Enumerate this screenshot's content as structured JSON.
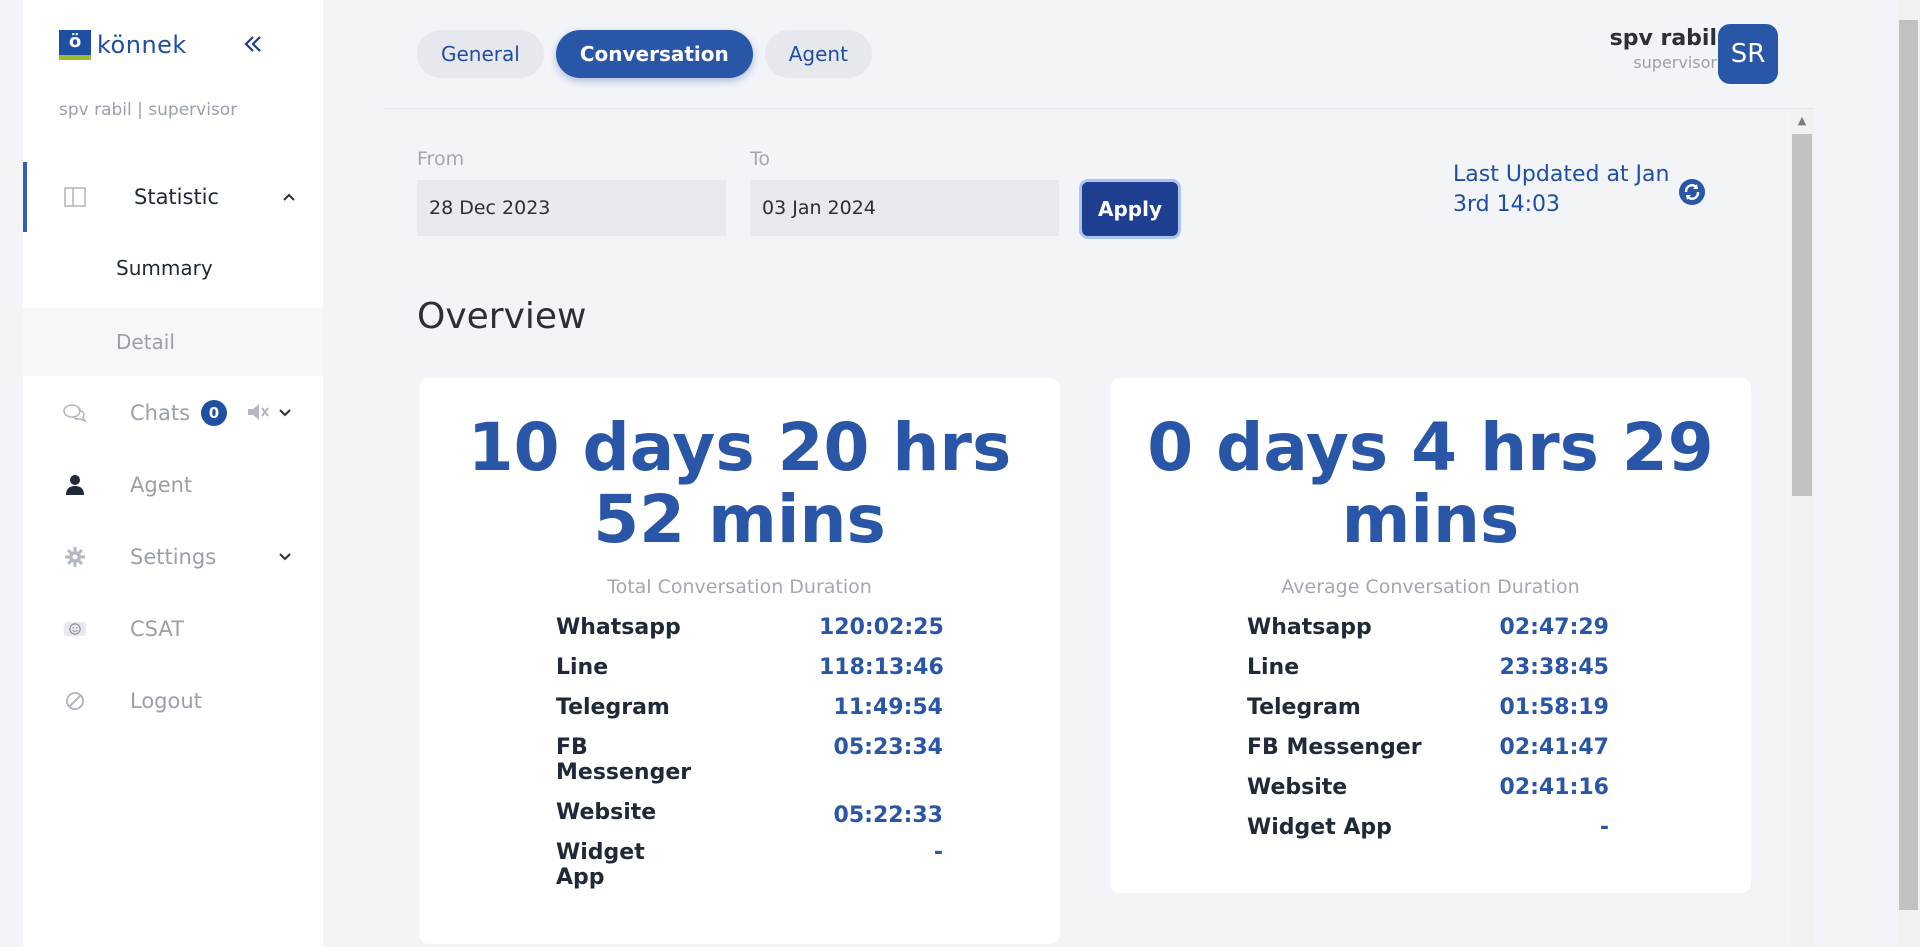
{
  "sidebar": {
    "logo_text": "könnek",
    "logo_mark": "ö",
    "user_line": "spv rabil | supervisor",
    "items": {
      "statistic": "Statistic",
      "summary": "Summary",
      "detail": "Detail",
      "chats": "Chats",
      "chats_badge": "0",
      "agent": "Agent",
      "settings": "Settings",
      "csat": "CSAT",
      "logout": "Logout"
    },
    "icons": [
      "double-chevron-left-icon",
      "layout-icon",
      "chat-bubbles-icon",
      "mute-icon",
      "person-icon",
      "gear-icon",
      "emoji-icon",
      "ban-icon"
    ]
  },
  "header": {
    "tabs": [
      "General",
      "Conversation",
      "Agent"
    ],
    "active_tab": "Conversation",
    "user_name": "spv rabil",
    "user_role": "supervisor",
    "avatar_initials": "SR"
  },
  "filters": {
    "from_label": "From",
    "from_value": "28 Dec 2023",
    "to_label": "To",
    "to_value": "03 Jan 2024",
    "apply_label": "Apply",
    "last_updated": "Last Updated at Jan 3rd 14:03"
  },
  "overview": {
    "title": "Overview",
    "total": {
      "value": "10 days 20 hrs 52 mins",
      "caption": "Total Conversation Duration",
      "rows": [
        {
          "label": "Whatsapp",
          "value": "120:02:25"
        },
        {
          "label": "Line",
          "value": "118:13:46"
        },
        {
          "label": "Telegram",
          "value": "11:49:54"
        },
        {
          "label": "FB Messenger",
          "value": "05:23:34"
        },
        {
          "label": "Website",
          "value": "05:22:33"
        },
        {
          "label": "Widget App",
          "value": "-"
        }
      ]
    },
    "average": {
      "value": "0 days 4 hrs 29 mins",
      "caption": "Average Conversation Duration",
      "rows": [
        {
          "label": "Whatsapp",
          "value": "02:47:29"
        },
        {
          "label": "Line",
          "value": "23:38:45"
        },
        {
          "label": "Telegram",
          "value": "01:58:19"
        },
        {
          "label": "FB Messenger",
          "value": "02:41:47"
        },
        {
          "label": "Website",
          "value": "02:41:16"
        },
        {
          "label": "Widget App",
          "value": "-"
        }
      ]
    }
  },
  "colors": {
    "accent": "#2a56a8",
    "apply": "#1e3f8f",
    "muted_text": "#9aa0aa",
    "background": "#f3f4f8"
  }
}
